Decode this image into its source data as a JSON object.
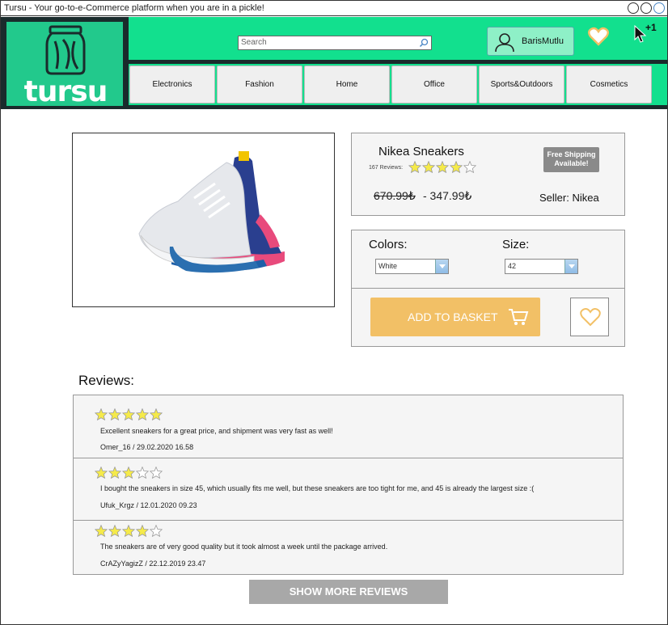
{
  "window": {
    "title": "Tursu - Your go-to-e-Commerce platform when you are in a pickle!"
  },
  "brand": {
    "logo_text": "tursu",
    "accent": "#12e08e",
    "logo_bg": "#22c98c",
    "dark": "#1a2b2c"
  },
  "search": {
    "placeholder": "Search"
  },
  "user": {
    "name": "BarisMutlu"
  },
  "cart": {
    "count": "+1"
  },
  "nav": {
    "items": [
      {
        "label": "Electronics"
      },
      {
        "label": "Fashion"
      },
      {
        "label": "Home"
      },
      {
        "label": "Office"
      },
      {
        "label": "Sports&Outdoors"
      },
      {
        "label": "Cosmetics"
      }
    ]
  },
  "product": {
    "name": "Nikea Sneakers",
    "reviews_count": "167 Reviews:",
    "rating": 4,
    "shipping_badge": "Free Shipping Available!",
    "old_price": "670.99₺",
    "new_price": "- 347.99₺",
    "seller": "Seller: Nikea"
  },
  "options": {
    "colors_label": "Colors:",
    "color_value": "White",
    "size_label": "Size:",
    "size_value": "42"
  },
  "actions": {
    "add_to_basket": "ADD TO BASKET",
    "show_more": "SHOW MORE REVIEWS"
  },
  "reviews": {
    "title": "Reviews:",
    "items": [
      {
        "rating": 5,
        "text": "Excellent sneakers for a great price, and shipment was very fast as well!",
        "author": "Omer_16 / 29.02.2020 16.58"
      },
      {
        "rating": 3,
        "text": "I bought the sneakers in size 45, which usually fits me well, but these sneakers are too tight for me, and 45 is already the largest size :(",
        "author": "Ufuk_Krgz / 12.01.2020 09.23"
      },
      {
        "rating": 4,
        "text": "The sneakers are of very good quality but it took almost a week until the package arrived.",
        "author": "CrAZyYagizZ / 22.12.2019 23.47"
      }
    ]
  }
}
